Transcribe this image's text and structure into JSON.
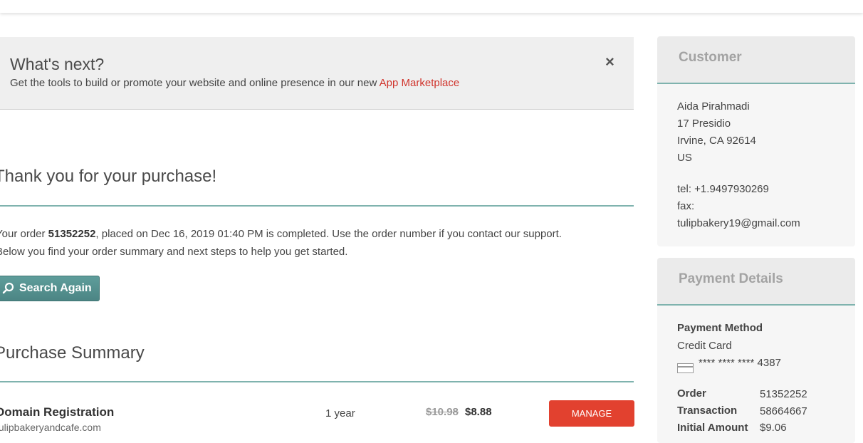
{
  "notice": {
    "title": "What's next?",
    "text": "Get the tools to build or promote your website and online presence in our new ",
    "link": "App Marketplace",
    "close": "×"
  },
  "main": {
    "thanks": "Thank you for your purchase!",
    "order_prefix": "Your order ",
    "order_number": "51352252",
    "order_suffix": ", placed on Dec 16, 2019 01:40 PM is completed. Use the order number if you contact our support.",
    "order_line2": "Below you find your order summary and next steps to help you get started.",
    "search_button": "Search Again",
    "summary_title": "Purchase Summary"
  },
  "item": {
    "name": "Domain Registration",
    "domain": "tulipbakeryandcafe.com",
    "period": "1 year",
    "old_price": "$10.98",
    "new_price": "$8.88",
    "manage": "MANAGE"
  },
  "customer": {
    "title": "Customer",
    "name": "Aida Pirahmadi",
    "street": "17 Presidio",
    "city": "Irvine, CA 92614",
    "country": "US",
    "tel": "tel: +1.9497930269",
    "fax": "fax:",
    "email": "tulipbakery19@gmail.com"
  },
  "payment": {
    "title": "Payment Details",
    "method_label": "Payment Method",
    "method": "Credit Card",
    "card": "**** **** **** 4387",
    "order_label": "Order",
    "order_value": "51352252",
    "transaction_label": "Transaction",
    "transaction_value": "58664667",
    "initial_label": "Initial Amount",
    "initial_value": "$9.06"
  },
  "colors": {
    "accent_teal": "#5e9d9b",
    "link_red": "#d0342c",
    "manage_red": "#e2412f",
    "rule": "#7fb3ae"
  },
  "icons": [
    "close-icon",
    "search-icon",
    "credit-card-icon"
  ]
}
